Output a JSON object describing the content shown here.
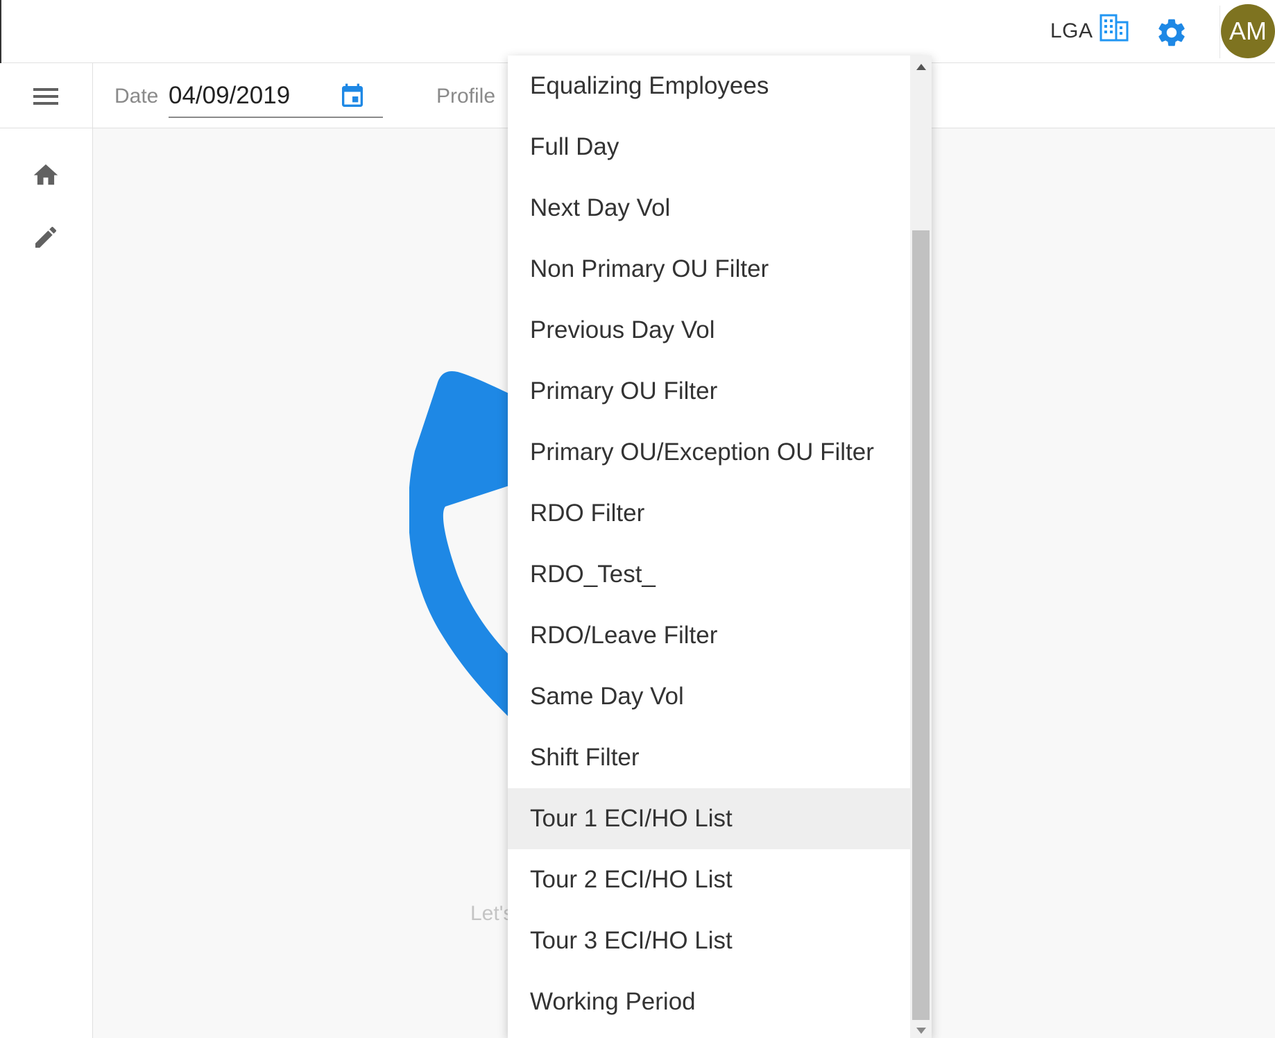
{
  "header": {
    "org_code": "LGA",
    "org_icon": "building-icon",
    "settings_icon": "gear-icon",
    "avatar_initials": "AM",
    "avatar_color": "#7e7320"
  },
  "filters": {
    "date_label": "Date",
    "date_value": "04/09/2019",
    "calendar_icon": "calendar-icon",
    "profile_label": "Profile"
  },
  "sidebar": {
    "menu_icon": "hamburger-menu-icon",
    "items": [
      {
        "icon": "home-icon"
      },
      {
        "icon": "edit-icon"
      }
    ]
  },
  "main": {
    "placeholder_text": "Let's",
    "accent_color": "#1e88e5"
  },
  "dropdown": {
    "options": [
      "Equalizing Employees",
      "Full Day",
      "Next Day Vol",
      "Non Primary OU Filter",
      "Previous Day Vol",
      "Primary OU Filter",
      "Primary OU/Exception OU Filter",
      "RDO Filter",
      "RDO_Test_",
      "RDO/Leave Filter",
      "Same Day Vol",
      "Shift Filter",
      "Tour 1 ECI/HO List",
      "Tour 2 ECI/HO List",
      "Tour 3 ECI/HO List",
      "Working Period"
    ],
    "highlighted_option": "Tour 1 ECI/HO List"
  }
}
